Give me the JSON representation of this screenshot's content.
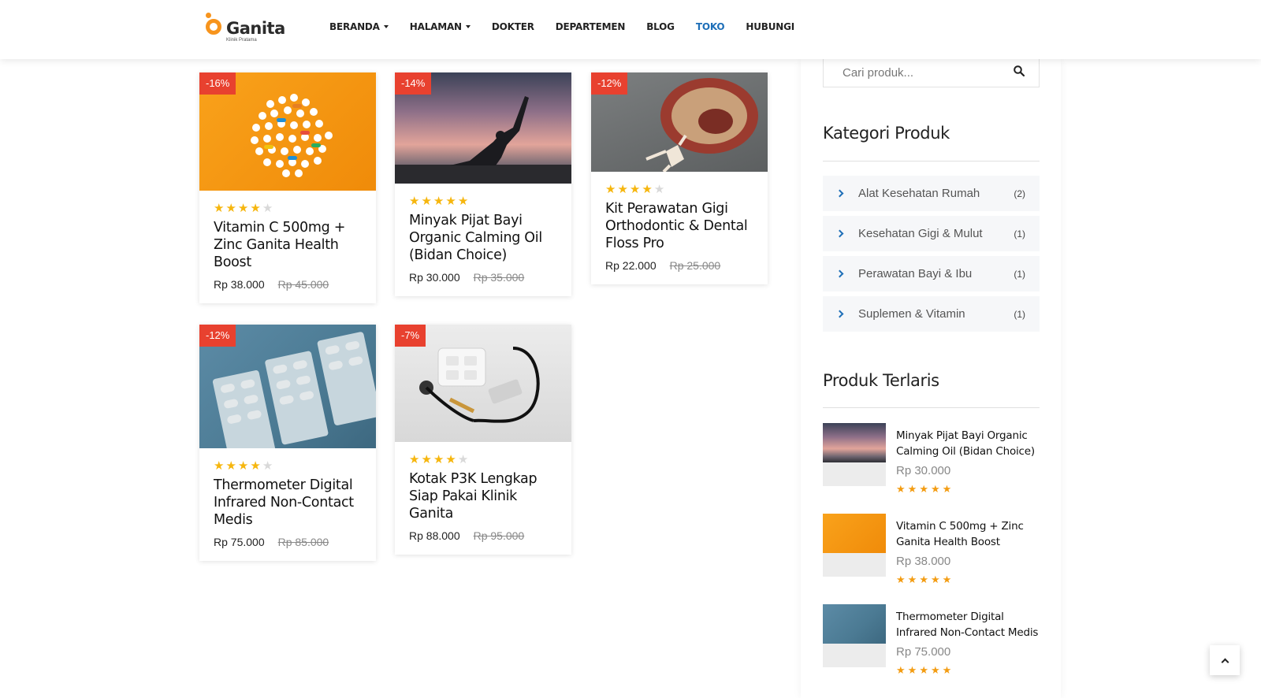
{
  "header": {
    "logo_name": "Ganita",
    "logo_sub": "Klinik Pratama",
    "nav": [
      {
        "label": "BERANDA",
        "dropdown": true
      },
      {
        "label": "HALAMAN",
        "dropdown": true
      },
      {
        "label": "DOKTER",
        "dropdown": false
      },
      {
        "label": "DEPARTEMEN",
        "dropdown": false
      },
      {
        "label": "BLOG",
        "dropdown": false
      },
      {
        "label": "TOKO",
        "dropdown": false,
        "active": true
      },
      {
        "label": "HUBUNGI",
        "dropdown": false
      }
    ]
  },
  "products": [
    {
      "badge": "-16%",
      "title": "Vitamin C 500mg + Zinc Ganita Health Boost",
      "price": "Rp 38.000",
      "old_price": "Rp 45.000",
      "rating": 4
    },
    {
      "badge": "-14%",
      "title": "Minyak Pijat Bayi Organic Calming Oil (Bidan Choice)",
      "price": "Rp 30.000",
      "old_price": "Rp 35.000",
      "rating": 5
    },
    {
      "badge": "-12%",
      "title": "Kit Perawatan Gigi Orthodontic & Dental Floss Pro",
      "price": "Rp 22.000",
      "old_price": "Rp 25.000",
      "rating": 4
    },
    {
      "badge": "-12%",
      "title": "Thermometer Digital Infrared Non-Contact Medis",
      "price": "Rp 75.000",
      "old_price": "Rp 85.000",
      "rating": 4
    },
    {
      "badge": "-7%",
      "title": "Kotak P3K Lengkap Siap Pakai Klinik Ganita",
      "price": "Rp 88.000",
      "old_price": "Rp 95.000",
      "rating": 4
    }
  ],
  "sidebar": {
    "search_placeholder": "Cari produk...",
    "categories_title": "Kategori Produk",
    "categories": [
      {
        "label": "Alat Kesehatan Rumah",
        "count": "(2)"
      },
      {
        "label": "Kesehatan Gigi & Mulut",
        "count": "(1)"
      },
      {
        "label": "Perawatan Bayi & Ibu",
        "count": "(1)"
      },
      {
        "label": "Suplemen & Vitamin",
        "count": "(1)"
      }
    ],
    "bestsellers_title": "Produk Terlaris",
    "bestsellers": [
      {
        "name": "Minyak Pijat Bayi Organic Calming Oil (Bidan Choice)",
        "price": "Rp 30.000",
        "rating": 5
      },
      {
        "name": "Vitamin C 500mg + Zinc Ganita Health Boost",
        "price": "Rp 38.000",
        "rating": 5
      },
      {
        "name": "Thermometer Digital Infrared Non-Contact Medis",
        "price": "Rp 75.000",
        "rating": 5
      }
    ]
  },
  "colors": {
    "accent": "#1e6fb8",
    "brand_orange": "#f7941d",
    "sale_badge": "#e8412f",
    "star": "#f6b60e"
  }
}
